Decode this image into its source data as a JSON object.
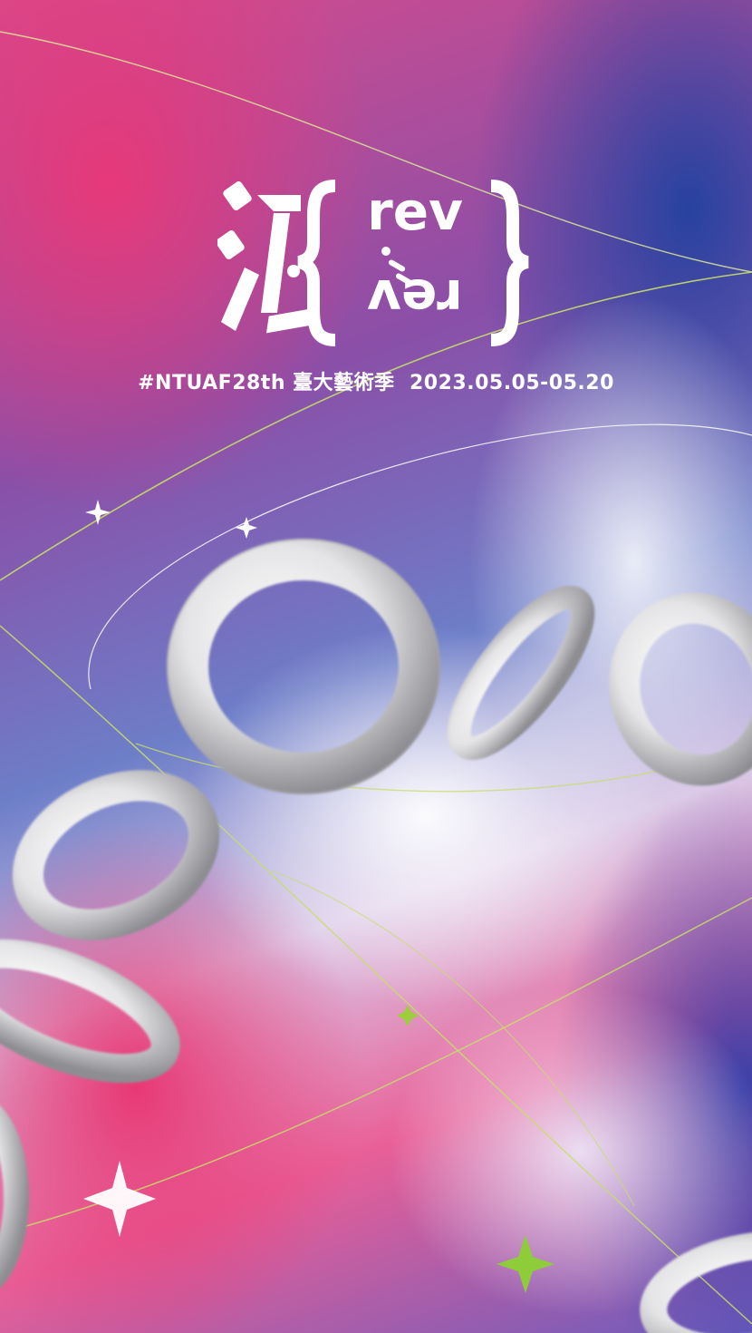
{
  "festival": {
    "logo_text_top": "rev",
    "logo_text_bottom": "rev",
    "logo_char": "汎",
    "hashtag": "#NTUAF28th",
    "name_zh": "臺大藝術季",
    "dates": "2023.05.05-05.20"
  },
  "colors": {
    "pink": "#e6397a",
    "blue": "#2742a0",
    "line_green": "#b6d94a",
    "ring": "#e8e8e8",
    "text": "#ffffff"
  },
  "icons": [
    "sparkle-white",
    "sparkle-green"
  ]
}
